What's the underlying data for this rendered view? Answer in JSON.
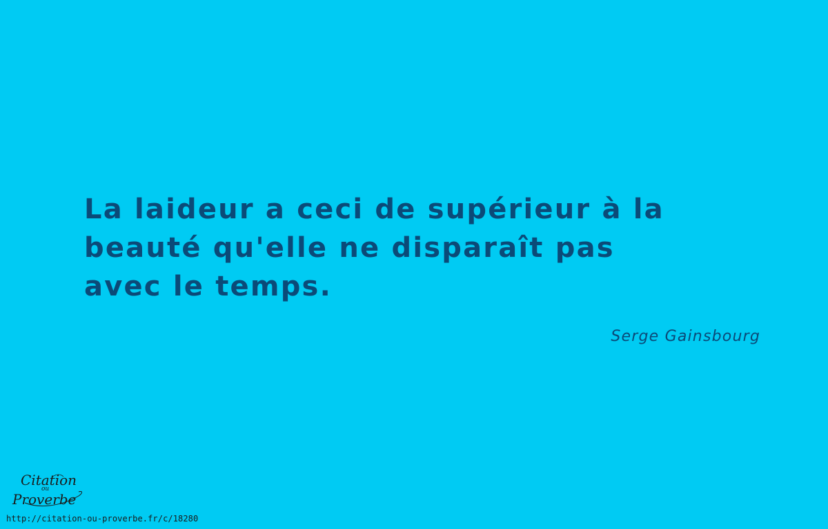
{
  "quote": {
    "lines": [
      "La laideur a ceci de supérieur à la",
      "beauté qu'elle ne disparaît pas",
      "avec le temps."
    ],
    "author": "Serge Gainsbourg"
  },
  "footer": {
    "logo": {
      "line1": "Citation",
      "line2": "ou",
      "line3": "Proverbe"
    },
    "url": "http://citation-ou-proverbe.fr/c/18280"
  },
  "colors": {
    "background": "#00cbf3",
    "text": "#0b4a78",
    "footer_text": "#1a1a1a"
  }
}
